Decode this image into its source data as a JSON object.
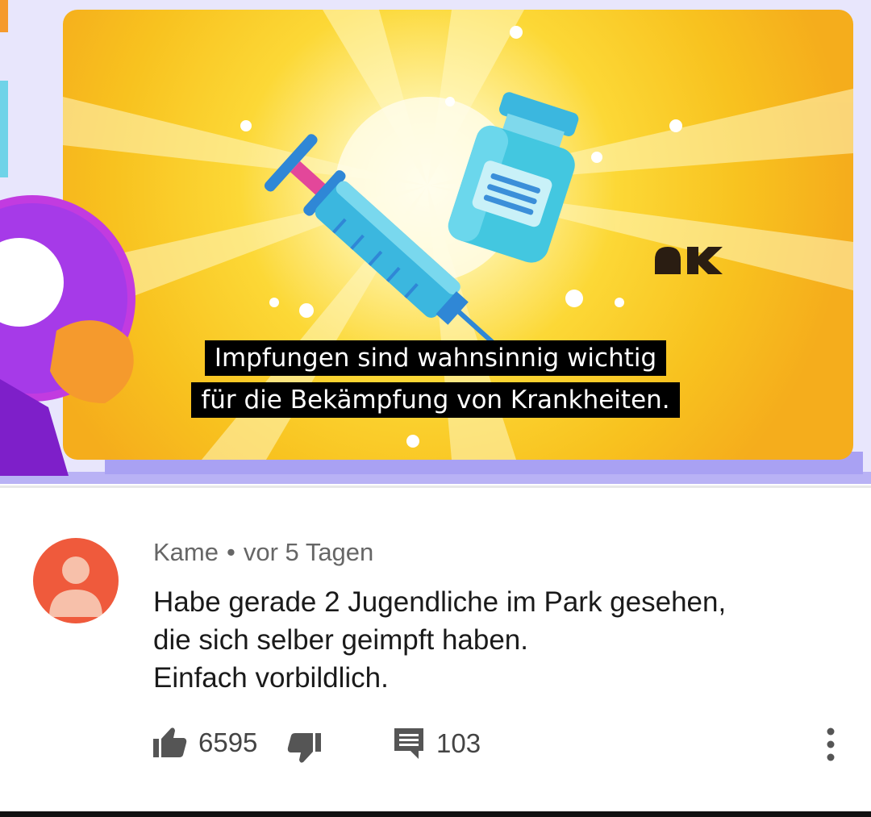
{
  "video": {
    "caption_line1": "Impfungen sind wahnsinnig wichtig",
    "caption_line2": "für die Bekämpfung von Krankheiten.",
    "channel_logo": "ak-logo",
    "colors": {
      "background": "#f7cf2a",
      "syringe": "#3bb7df",
      "vial": "#43c7e0",
      "character": "#a53ae6"
    }
  },
  "comment": {
    "author": "Kame",
    "separator": "•",
    "time": "vor 5 Tagen",
    "text_lines": [
      "Habe gerade 2 Jugendliche im Park gesehen,",
      "die sich selber geimpft haben.",
      "Einfach vorbildlich."
    ],
    "avatar_icon": "default-user-avatar",
    "avatar_color": "#ef5a3c"
  },
  "actions": {
    "like_icon": "thumbs-up-icon",
    "like_count": "6595",
    "dislike_icon": "thumbs-down-icon",
    "reply_icon": "comment-icon",
    "reply_count": "103",
    "more_icon": "more-vert-icon"
  }
}
